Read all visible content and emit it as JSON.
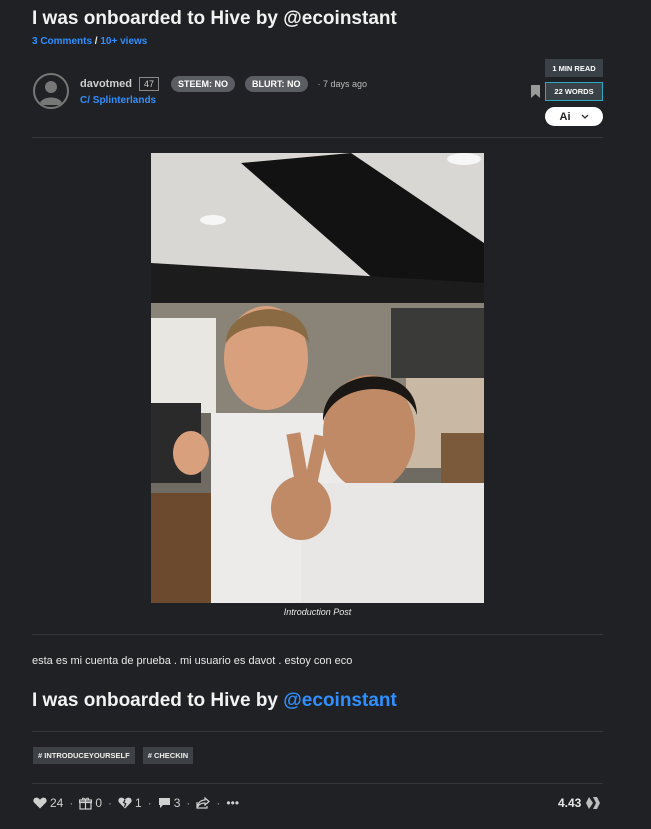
{
  "post": {
    "title": "I was onboarded to Hive by @ecoinstant",
    "comments_link": "3 Comments",
    "separator": " / ",
    "views_link": "10+ views"
  },
  "author": {
    "name": "davotmed",
    "reputation": "47",
    "steem_pill": "STEEM: NO",
    "blurt_pill": "BLURT: NO",
    "time_ago": "· 7 days ago",
    "community": "C/ Splinterlands"
  },
  "badges": {
    "read_time": "1 MIN READ",
    "word_count": "22 WORDS",
    "ai_label": "Ai"
  },
  "content": {
    "image_caption": "Introduction Post",
    "body_text": "esta es mi cuenta de prueba . mi usuario es davot . estoy con eco",
    "heading_prefix": "I was onboarded to Hive by ",
    "heading_mention": "@ecoinstant"
  },
  "tags": [
    "# INTRODUCEYOURSELF",
    "# CHECKIN"
  ],
  "footer": {
    "upvotes": "24",
    "gifts": "0",
    "downvotes": "1",
    "comments": "3",
    "more": "•••",
    "payout": "4.43"
  },
  "icons": {
    "avatar": "avatar-placeholder-icon",
    "bookmark": "bookmark-icon",
    "ai_dropdown": "chevron-down-icon",
    "upvote": "heart-icon",
    "gift": "gift-icon",
    "downvote": "broken-heart-icon",
    "comment": "comment-icon",
    "share": "share-icon",
    "hive": "hive-logo-icon"
  }
}
